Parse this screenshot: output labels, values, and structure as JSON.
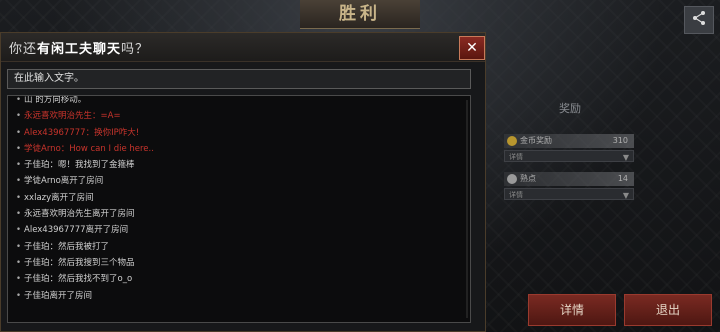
{
  "background": {
    "victory_title": "胜利",
    "rewards": {
      "title": "奖励",
      "rows": [
        {
          "label": "金币奖励",
          "value": "310",
          "select": "详情"
        },
        {
          "label": "熟点",
          "value": "14",
          "select": "详情"
        }
      ]
    },
    "buttons": {
      "details": "详情",
      "exit": "退出"
    }
  },
  "dialog": {
    "title_prefix": "你还",
    "title_bold": "有闲工夫聊天",
    "title_suffix": "吗？",
    "close_label": "✕",
    "input_value": "在此输入文字。",
    "messages": [
      {
        "text": "山 的方向移动。",
        "color": "white"
      },
      {
        "text": "永远喜欢明治先生：=A=",
        "color": "red"
      },
      {
        "text": "Alex43967777：换你IP咋大!",
        "color": "red"
      },
      {
        "text": "学徒Arno：How can I die here..",
        "color": "red"
      },
      {
        "text": "子佳珀：嗯！我找到了金箍棒",
        "color": "white"
      },
      {
        "text": "学徒Arno离开了房间",
        "color": "white"
      },
      {
        "text": "xxlazy离开了房间",
        "color": "white"
      },
      {
        "text": "永远喜欢明治先生离开了房间",
        "color": "white"
      },
      {
        "text": "Alex43967777离开了房间",
        "color": "white"
      },
      {
        "text": "子佳珀：然后我被打了",
        "color": "white"
      },
      {
        "text": "子佳珀：然后我搜到三个物品",
        "color": "white"
      },
      {
        "text": "子佳珀：然后我找不到了o_o",
        "color": "white"
      },
      {
        "text": "子佳珀离开了房间",
        "color": "white"
      }
    ]
  }
}
